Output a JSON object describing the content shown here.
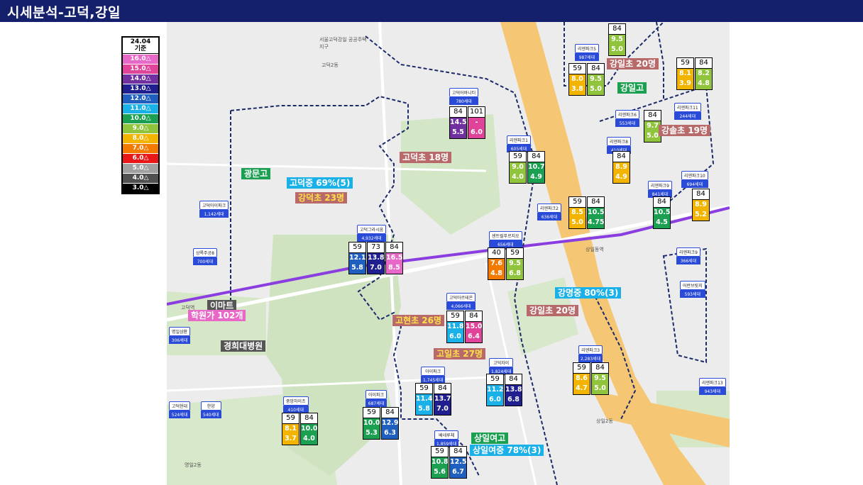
{
  "title": "시세분석-고덕,강일",
  "legend": {
    "header_line1": "24.04",
    "header_line2": "기준",
    "items": [
      {
        "label": "16.0△",
        "color": "#e868c8"
      },
      {
        "label": "15.0△",
        "color": "#e0449a"
      },
      {
        "label": "14.0△",
        "color": "#7030a0"
      },
      {
        "label": "13.0△",
        "color": "#1f1f8f"
      },
      {
        "label": "12.0△",
        "color": "#1f5fbf"
      },
      {
        "label": "11.0△",
        "color": "#1ab0e8"
      },
      {
        "label": "10.0△",
        "color": "#1aa050"
      },
      {
        "label": "9.0△",
        "color": "#8fc43c"
      },
      {
        "label": "8.0△",
        "color": "#f2b400"
      },
      {
        "label": "7.0△",
        "color": "#f27a00"
      },
      {
        "label": "6.0△",
        "color": "#e81818"
      },
      {
        "label": "5.0△",
        "color": "#a0a0a0"
      },
      {
        "label": "4.0△",
        "color": "#505050"
      },
      {
        "label": "3.0△",
        "color": "#000000"
      }
    ]
  },
  "complexes": [
    {
      "name": "고덕아르테온",
      "households": "4,066세대"
    },
    {
      "name": "고덕그라시움",
      "households": "4,932세대"
    },
    {
      "name": "센트럴푸르지오",
      "households": "656세대"
    },
    {
      "name": "고덕아이파크",
      "households": "1,142세대"
    },
    {
      "name": "상록주공8",
      "households": "700세대"
    },
    {
      "name": "아이파크",
      "households": "1,745세대"
    },
    {
      "name": "고덕자이",
      "households": "1,824세대"
    },
    {
      "name": "아이파크",
      "households": "687세대"
    },
    {
      "name": "중앙하이츠",
      "households": "410세대"
    },
    {
      "name": "베네루체",
      "households": "1,859세대"
    },
    {
      "name": "고덕어바니티",
      "households": "780세대"
    },
    {
      "name": "리엔파크1",
      "households": "605세대"
    },
    {
      "name": "리엔파크2",
      "households": "636세대"
    },
    {
      "name": "리엔파크3",
      "households": "2,283세대"
    },
    {
      "name": "리엔파크5",
      "households": "987세대"
    },
    {
      "name": "리엔파크6",
      "households": "553세대"
    },
    {
      "name": "리엔파크8",
      "households": "410세대"
    },
    {
      "name": "리엔파크9",
      "households": "841세대"
    },
    {
      "name": "리엔파크10",
      "households": "694세대"
    },
    {
      "name": "리엔파크11",
      "households": "244세대"
    },
    {
      "name": "리엔파크9",
      "households": "366세대"
    },
    {
      "name": "고덕현대",
      "households": "524세대"
    },
    {
      "name": "한양",
      "households": "540세대"
    },
    {
      "name": "명일삼환",
      "households": "306세대"
    },
    {
      "name": "어반브릿지",
      "households": "593세대"
    },
    {
      "name": "리엔파크13",
      "households": "943세대"
    }
  ],
  "price_boxes": [
    {
      "id": "artheon",
      "sizes": [
        "59",
        "84"
      ],
      "values": [
        [
          "11.8",
          "6.0"
        ],
        [
          "15.0",
          "6.4"
        ]
      ],
      "colors": [
        "#1ab0e8",
        "#e0449a"
      ]
    },
    {
      "id": "gracium",
      "sizes": [
        "59",
        "73",
        "84"
      ],
      "values": [
        [
          "12.1",
          "5.8"
        ],
        [
          "13.8",
          "7.0"
        ],
        [
          "16.5",
          "8.5"
        ]
      ],
      "colors": [
        "#1f5fbf",
        "#1f1f8f",
        "#e868c8"
      ]
    },
    {
      "id": "central",
      "sizes": [
        "40",
        "59"
      ],
      "values": [
        [
          "7.6",
          "4.8"
        ],
        [
          "9.5",
          "6.8"
        ]
      ],
      "colors": [
        "#f27a00",
        "#8fc43c"
      ]
    },
    {
      "id": "ipark1745",
      "sizes": [
        "59",
        "84"
      ],
      "values": [
        [
          "11.4",
          "5.8"
        ],
        [
          "13.7",
          "7.0"
        ]
      ],
      "colors": [
        "#1ab0e8",
        "#1f1f8f"
      ]
    },
    {
      "id": "xi",
      "sizes": [
        "59",
        "84"
      ],
      "values": [
        [
          "11.2",
          "6.0"
        ],
        [
          "13.8",
          "6.8"
        ]
      ],
      "colors": [
        "#1ab0e8",
        "#1f1f8f"
      ]
    },
    {
      "id": "ipark687",
      "sizes": [
        "59",
        "84"
      ],
      "values": [
        [
          "10.0",
          "5.3"
        ],
        [
          "12.9",
          "6.3"
        ]
      ],
      "colors": [
        "#1aa050",
        "#1f5fbf"
      ]
    },
    {
      "id": "central410",
      "sizes": [
        "59",
        "84"
      ],
      "values": [
        [
          "8.1",
          "3.7"
        ],
        [
          "10.0",
          "4.0"
        ]
      ],
      "colors": [
        "#f2b400",
        "#1aa050"
      ]
    },
    {
      "id": "benerushe",
      "sizes": [
        "59",
        "84"
      ],
      "values": [
        [
          "10.8",
          "5.6"
        ],
        [
          "12.5",
          "6.7"
        ]
      ],
      "colors": [
        "#1aa050",
        "#1f5fbf"
      ]
    },
    {
      "id": "urbanity",
      "sizes": [
        "84",
        "101"
      ],
      "values": [
        [
          "14.5",
          "5.5"
        ],
        [
          "-",
          "6.0"
        ]
      ],
      "colors": [
        "#7030a0",
        "#e0449a"
      ]
    },
    {
      "id": "rien1",
      "sizes": [
        "59",
        "84"
      ],
      "values": [
        [
          "9.0",
          "4.0"
        ],
        [
          "10.7",
          "4.9"
        ]
      ],
      "colors": [
        "#8fc43c",
        "#1aa050"
      ]
    },
    {
      "id": "rien2",
      "sizes": [
        "59",
        "84"
      ],
      "values": [
        [
          "8.5",
          "5.0"
        ],
        [
          "10.5",
          "4.75"
        ]
      ],
      "colors": [
        "#f2b400",
        "#1aa050"
      ]
    },
    {
      "id": "rien3",
      "sizes": [
        "59",
        "84"
      ],
      "values": [
        [
          "8.6",
          "4.7"
        ],
        [
          "9.5",
          "5.0"
        ]
      ],
      "colors": [
        "#f2b400",
        "#8fc43c"
      ]
    },
    {
      "id": "rien5",
      "sizes": [
        "59",
        "84"
      ],
      "values": [
        [
          "8.0",
          "3.8"
        ],
        [
          "9.5",
          "5.0"
        ]
      ],
      "colors": [
        "#f2b400",
        "#8fc43c"
      ]
    },
    {
      "id": "top84",
      "sizes": [
        "84"
      ],
      "values": [
        [
          "9.5",
          "5.0"
        ]
      ],
      "colors": [
        "#8fc43c"
      ]
    },
    {
      "id": "rien6",
      "sizes": [
        "84"
      ],
      "values": [
        [
          "9.7",
          "5.0"
        ]
      ],
      "colors": [
        "#8fc43c"
      ]
    },
    {
      "id": "rien8",
      "sizes": [
        "84"
      ],
      "values": [
        [
          "8.9",
          "4.9"
        ]
      ],
      "colors": [
        "#f2b400"
      ]
    },
    {
      "id": "rien9",
      "sizes": [
        "84"
      ],
      "values": [
        [
          "10.5",
          "4.5"
        ]
      ],
      "colors": [
        "#1aa050"
      ]
    },
    {
      "id": "rien10",
      "sizes": [
        "84"
      ],
      "values": [
        [
          "8.9",
          "5.2"
        ]
      ],
      "colors": [
        "#f2b400"
      ]
    },
    {
      "id": "rien11",
      "sizes": [
        "59",
        "84"
      ],
      "values": [
        [
          "8.1",
          "3.9"
        ],
        [
          "8.2",
          "4.8"
        ]
      ],
      "colors": [
        "#f2b400",
        "#8fc43c"
      ]
    }
  ],
  "school_tags": [
    {
      "text": "강일초 20명",
      "bg": "#b86a6a",
      "fg": "#ffffff"
    },
    {
      "text": "강일고",
      "bg": "#1aa050",
      "fg": "#ffffff"
    },
    {
      "text": "강솔초 19명",
      "bg": "#b86a6a",
      "fg": "#ffffff"
    },
    {
      "text": "고덕초 18명",
      "bg": "#b86a6a",
      "fg": "#ffffff"
    },
    {
      "text": "광문고",
      "bg": "#1aa050",
      "fg": "#ffffff"
    },
    {
      "text": "고덕중 69%(5)",
      "bg": "#1ab0e8",
      "fg": "#ffffff"
    },
    {
      "text": "강덕초 23명",
      "bg": "#b86a6a",
      "fg": "#ffe14a"
    },
    {
      "text": "강명중 80%(3)",
      "bg": "#1ab0e8",
      "fg": "#ffffff"
    },
    {
      "text": "강일초 20명",
      "bg": "#b86a6a",
      "fg": "#ffffff"
    },
    {
      "text": "고현초 26명",
      "bg": "#b86a6a",
      "fg": "#ffe14a"
    },
    {
      "text": "고일초 27명",
      "bg": "#b86a6a",
      "fg": "#ffe14a"
    },
    {
      "text": "상일여고",
      "bg": "#1aa050",
      "fg": "#ffffff"
    },
    {
      "text": "상일여중 78%(3)",
      "bg": "#1ab0e8",
      "fg": "#ffffff"
    },
    {
      "text": "이마트",
      "bg": "#555555",
      "fg": "#ffffff"
    },
    {
      "text": "학원가 102개",
      "bg": "#e868c8",
      "fg": "#ffffff"
    },
    {
      "text": "경희대병원",
      "bg": "#555555",
      "fg": "#ffffff"
    }
  ],
  "place_labels": {
    "seoul_godeok": "서울고덕강일 공공주택지구",
    "godeok2": "고덕2동",
    "sangil2": "상일2동",
    "myeongil2": "명일2동",
    "sangil_station": "상일동역",
    "godeok_station": "고덕역"
  }
}
